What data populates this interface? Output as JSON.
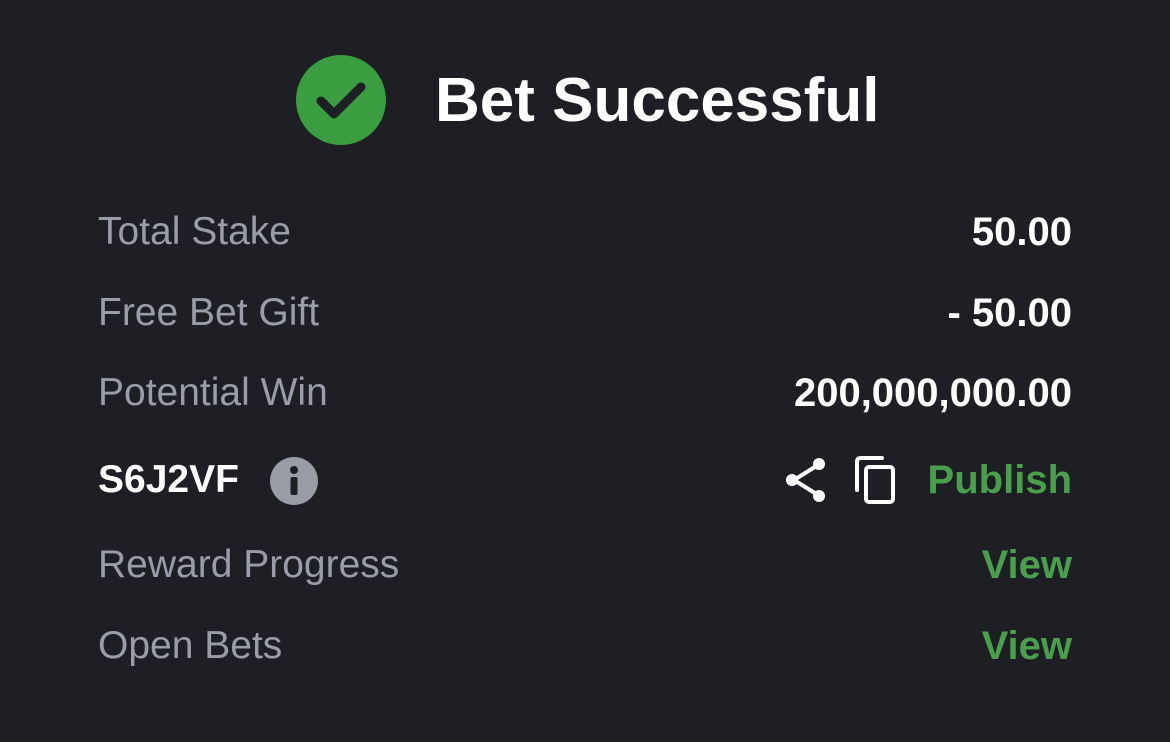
{
  "header": {
    "title": "Bet Successful",
    "status_icon": "check-circle-icon",
    "status_color": "#3a9d3f"
  },
  "rows": {
    "total_stake": {
      "label": "Total Stake",
      "value": "50.00"
    },
    "free_bet_gift": {
      "label": "Free Bet Gift",
      "value": "- 50.00"
    },
    "potential_win": {
      "label": "Potential Win",
      "value": "200,000,000.00"
    },
    "booking": {
      "code": "S6J2VF",
      "info_icon": "info-icon",
      "share_icon": "share-icon",
      "copy_icon": "copy-icon",
      "publish_label": "Publish"
    },
    "reward_progress": {
      "label": "Reward Progress",
      "link": "View"
    },
    "open_bets": {
      "label": "Open Bets",
      "link": "View"
    }
  },
  "colors": {
    "background": "#1e1f24",
    "accent_green": "#4a9f4c",
    "label_gray": "#9a9ca6",
    "value_white": "#ffffff"
  }
}
